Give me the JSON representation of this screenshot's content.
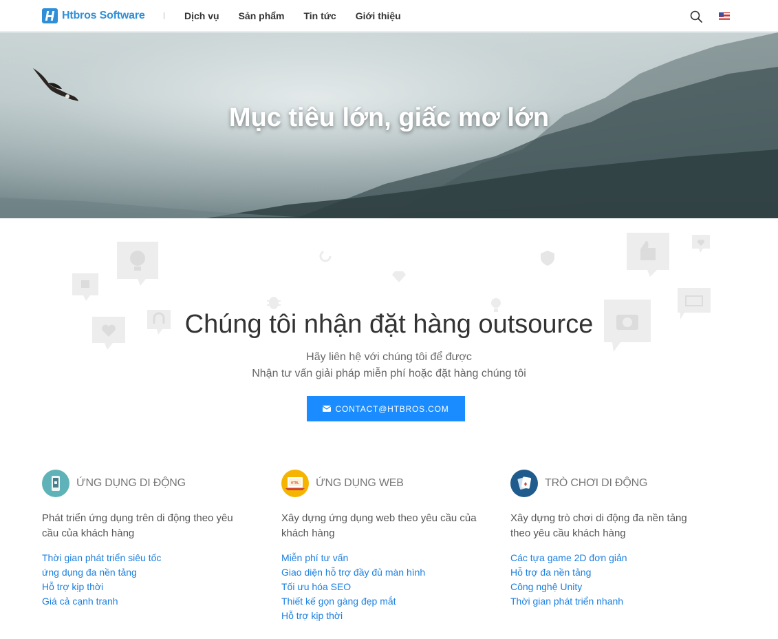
{
  "header": {
    "logo_text": "Htbros Software",
    "nav": [
      "Dịch vụ",
      "Sản phẩm",
      "Tin tức",
      "Giới thiệu"
    ]
  },
  "hero": {
    "title": "Mục tiêu lớn, giấc mơ lớn"
  },
  "outsource": {
    "title": "Chúng tôi nhận đặt hàng outsource",
    "subtitle_line1": "Hãy liên hệ với chúng tôi để được",
    "subtitle_line2": "Nhận tư vấn giải pháp miễn phí hoặc đặt hàng chúng tôi",
    "contact_label": "CONTACT@HTBROS.COM"
  },
  "services": [
    {
      "title": "Ứng dụng di động",
      "description": "Phát triển ứng dụng trên di động theo yêu cầu của khách hàng",
      "features": [
        "Thời gian phát triển siêu tốc",
        "ứng dụng đa nền tảng",
        "Hỗ trợ kịp thời",
        "Giá cả cạnh tranh"
      ],
      "icon_color": "#5fb3b8"
    },
    {
      "title": "Ứng dụng web",
      "description": "Xây dựng ứng dụng web theo yêu cầu của khách hàng",
      "features": [
        "Miễn phí tư vấn",
        "Giao diện hỗ trợ đầy đủ màn hình",
        "Tối ưu hóa SEO",
        "Thiết kế gọn gàng đẹp mắt",
        "Hỗ trợ kịp thời"
      ],
      "icon_color": "#f4b400"
    },
    {
      "title": "Trò chơi di động",
      "description": "Xây dựng trò chơi di động đa nền tảng theo yêu cầu khách hàng",
      "features": [
        "Các tựa game 2D đơn giản",
        "Hỗ trợ đa nền tảng",
        "Công nghệ Unity",
        "Thời gian phát triển nhanh"
      ],
      "icon_color": "#1f5b8c"
    }
  ],
  "colors": {
    "brand": "#2e8fd8",
    "button": "#1a8cff",
    "link": "#1a7fe0"
  }
}
